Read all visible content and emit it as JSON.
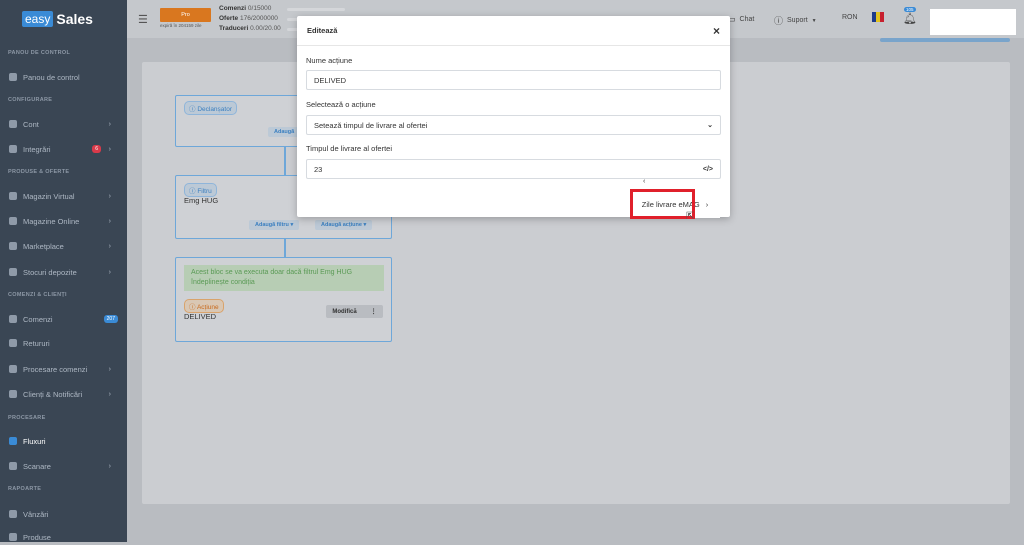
{
  "brand": {
    "logo_box": "easy",
    "logo_text": "Sales"
  },
  "sidebar": {
    "sections": [
      {
        "title": "PANOU DE CONTROL",
        "items": [
          {
            "label": "Panou de control",
            "icon": "grid-icon"
          }
        ]
      },
      {
        "title": "CONFIGURARE",
        "items": [
          {
            "label": "Cont",
            "icon": "user-icon",
            "chevron": "›"
          },
          {
            "label": "Integrări",
            "icon": "plug-icon",
            "badge": "6",
            "chevron": "›"
          }
        ]
      },
      {
        "title": "PRODUSE & OFERTE",
        "items": [
          {
            "label": "Magazin Virtual",
            "icon": "store-icon",
            "chevron": "›"
          },
          {
            "label": "Magazine Online",
            "icon": "globe-icon",
            "chevron": "›"
          },
          {
            "label": "Marketplace",
            "icon": "marketplace-icon",
            "chevron": "›"
          },
          {
            "label": "Stocuri depozite",
            "icon": "warehouse-icon",
            "chevron": "›"
          }
        ]
      },
      {
        "title": "COMENZI & CLIENȚI",
        "items": [
          {
            "label": "Comenzi",
            "icon": "cart-icon",
            "badge": "207"
          },
          {
            "label": "Retururi",
            "icon": "return-icon"
          },
          {
            "label": "Procesare comenzi",
            "icon": "process-icon",
            "chevron": "›"
          },
          {
            "label": "Clienți & Notificări",
            "icon": "users-icon",
            "chevron": "›"
          }
        ]
      },
      {
        "title": "PROCESARE",
        "items": [
          {
            "label": "Fluxuri",
            "icon": "flow-icon",
            "active": true
          },
          {
            "label": "Scanare",
            "icon": "barcode-icon",
            "chevron": "›"
          }
        ]
      },
      {
        "title": "RAPOARTE",
        "items": [
          {
            "label": "Vânzări",
            "icon": "dollar-icon"
          },
          {
            "label": "Produse",
            "icon": "box-icon"
          }
        ]
      }
    ]
  },
  "topbar": {
    "plan_label": "Pro",
    "plan_expiry": "expiră în 204159 zile",
    "quotas": [
      {
        "label": "Comenzi",
        "value": "0/15000"
      },
      {
        "label": "Oferte",
        "value": "176/2000000"
      },
      {
        "label": "Traduceri",
        "value": "0.00/20.00"
      }
    ],
    "chat_label": "Chat",
    "support_label": "Suport",
    "currency": "RON",
    "notif_count": "105"
  },
  "flow": {
    "trigger_chip": "Declanșator",
    "trigger_add_btn": "Adaugă",
    "filter_chip": "Filtru",
    "filter_value": "Emg HUG",
    "add_filter_btn": "Adaugă filtru",
    "add_action_btn": "Adaugă acțiune",
    "note": "Acest bloc se va executa doar dacă filtrul Emg HUG îndeplinește condiția",
    "action_chip": "Acțiune",
    "action_value": "DELIVED",
    "modify_btn": "Modifică"
  },
  "modal": {
    "title": "Editează",
    "close": "×",
    "name_label": "Nume acțiune",
    "name_value": "DELIVED",
    "action_label": "Selectează o acțiune",
    "action_value": "Setează timpul de livrare al ofertei",
    "time_label": "Timpul de livrare al ofertei",
    "time_value": "23",
    "code_icon": "</>",
    "dropdown_item": "Zile livrare eMAG"
  },
  "colors": {
    "sidebar": "#3a4654",
    "accent": "#3a8bd6",
    "plan": "#d9771f",
    "highlight": "#e0202b"
  }
}
